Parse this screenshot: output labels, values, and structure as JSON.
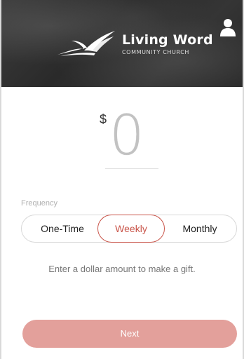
{
  "header": {
    "title": "Living Word",
    "subtitle": "COMMUNITY CHURCH",
    "logo_icon": "open-book-wings-icon",
    "profile_icon": "user-icon"
  },
  "amount": {
    "currency_symbol": "$",
    "value": "0"
  },
  "frequency": {
    "label": "Frequency",
    "options": [
      "One-Time",
      "Weekly",
      "Monthly"
    ],
    "selected": "Weekly"
  },
  "hint": "Enter a dollar amount to make a gift.",
  "next_button": {
    "label": "Next"
  },
  "colors": {
    "accent": "#c9554a",
    "button_bg": "#e3a09b",
    "header_bg": "#2f2f2f"
  }
}
